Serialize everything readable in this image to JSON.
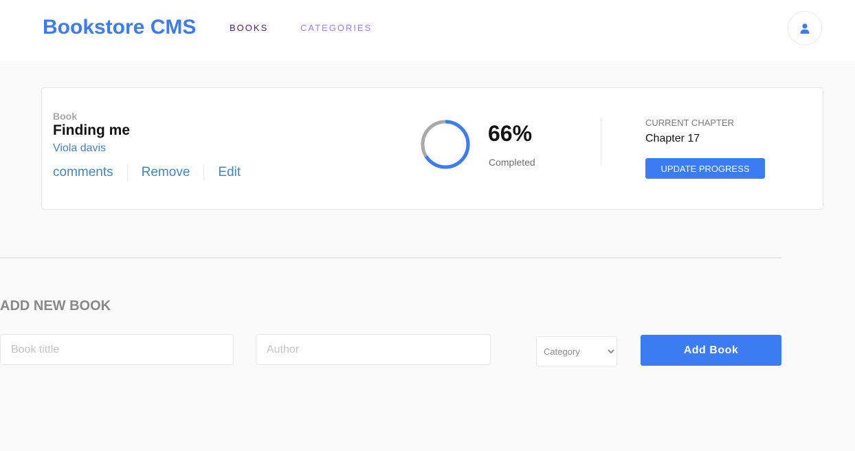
{
  "header": {
    "brand": "Bookstore CMS",
    "nav": [
      {
        "label": "BOOKS",
        "active": true
      },
      {
        "label": "CATEGORIES",
        "active": false
      }
    ],
    "avatar_icon": "user-icon"
  },
  "book": {
    "genre": "Book",
    "title": "Finding me",
    "author": "Viola davis",
    "actions": [
      "comments",
      "Remove",
      "Edit"
    ],
    "progress_percent": 66,
    "progress_label": "66%",
    "completed_label": "Completed",
    "current_chapter_label": "CURRENT CHAPTER",
    "current_chapter": "Chapter 17",
    "update_button": "UPDATE PROGRESS"
  },
  "form": {
    "title": "ADD NEW BOOK",
    "title_placeholder": "Book tittle",
    "author_placeholder": "Author",
    "category_selected": "Category",
    "submit_label": "Add Book"
  },
  "colors": {
    "primary": "#3b7cf2",
    "link": "#4386bf",
    "progress_fill": "#3b7cf2",
    "progress_track": "#a9a9a9"
  }
}
